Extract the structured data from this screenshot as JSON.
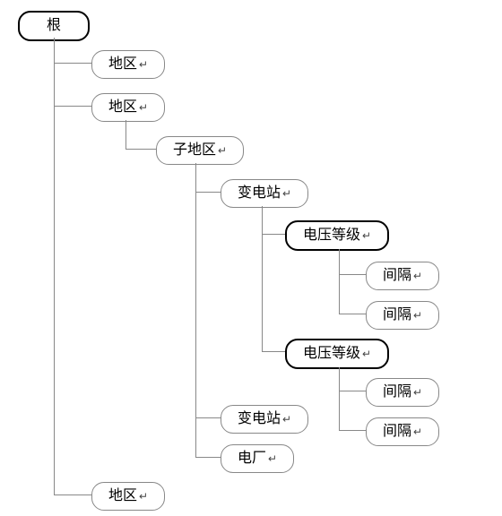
{
  "tree": {
    "root": "根",
    "region1": "地区",
    "region2": "地区",
    "subregion": "子地区",
    "substation1": "变电站",
    "voltage1": "电压等级",
    "bay1": "间隔",
    "bay2": "间隔",
    "voltage2": "电压等级",
    "bay3": "间隔",
    "bay4": "间隔",
    "substation2": "变电站",
    "plant": "电厂",
    "region3": "地区",
    "ret": "↵"
  }
}
